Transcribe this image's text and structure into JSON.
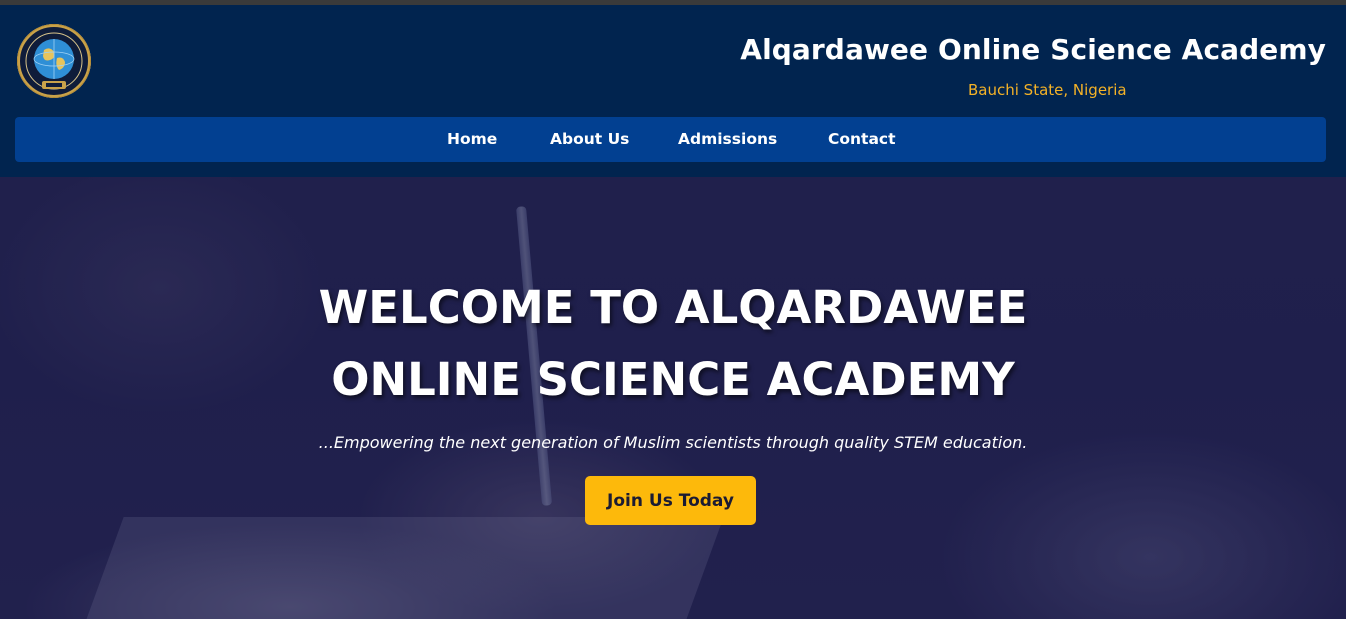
{
  "header": {
    "title": "Alqardawee Online Science Academy",
    "subtitle": "Bauchi State, Nigeria",
    "logo_icon": "academy-crest-globe"
  },
  "nav": {
    "items": [
      {
        "label": "Home"
      },
      {
        "label": "About Us"
      },
      {
        "label": "Admissions"
      },
      {
        "label": "Contact"
      }
    ]
  },
  "hero": {
    "title_line1": "WELCOME TO ALQARDAWEE",
    "title_line2": "ONLINE SCIENCE ACADEMY",
    "tagline": "...Empowering the next generation of Muslim scientists through quality STEM education.",
    "cta_label": "Join Us Today"
  },
  "colors": {
    "header_bg": "#01244f",
    "nav_bg": "#024091",
    "accent": "#f4b227",
    "cta_bg": "#fdb90b"
  }
}
